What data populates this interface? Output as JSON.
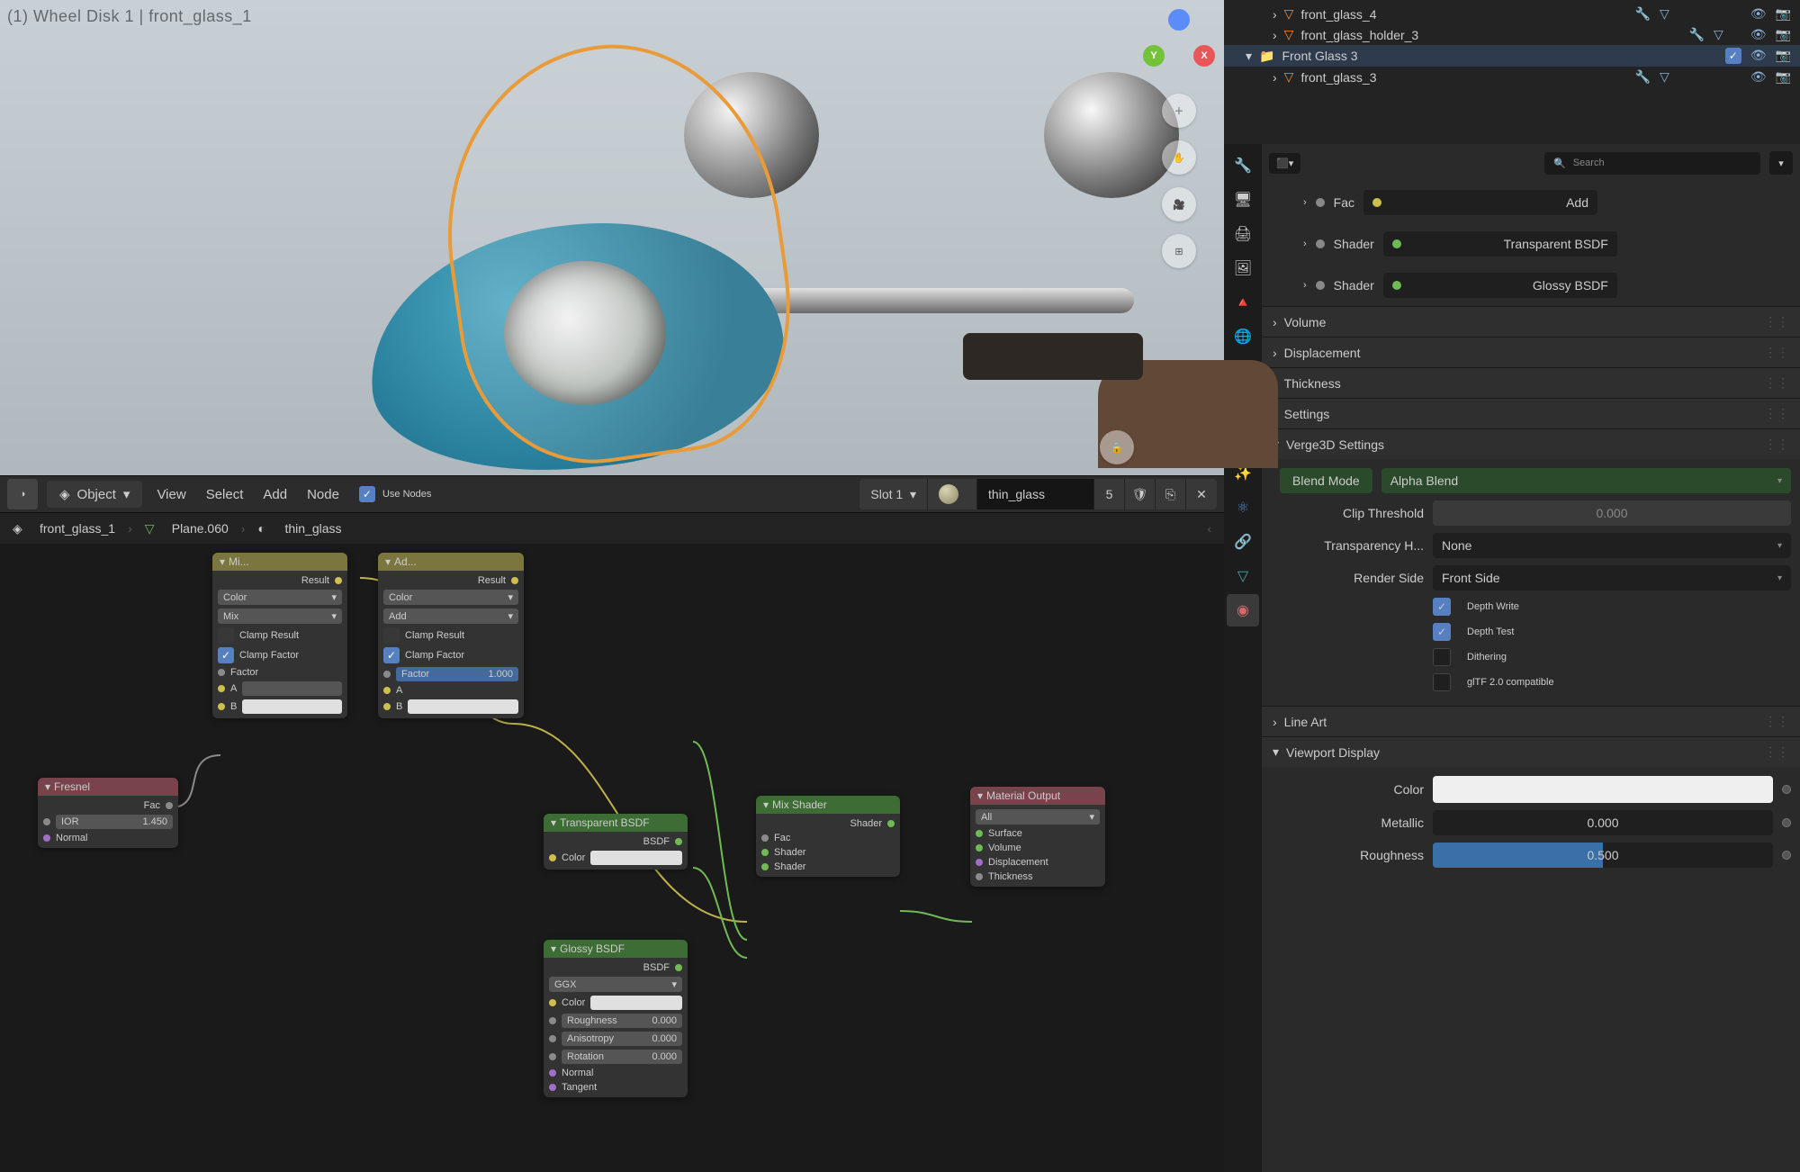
{
  "viewport": {
    "overlay_text": "(1) Wheel Disk 1 | front_glass_1",
    "gizmo": {
      "x": "X",
      "y": "Y",
      "z": ""
    }
  },
  "node_editor": {
    "header": {
      "mode": "Object",
      "menus": [
        "View",
        "Select",
        "Add",
        "Node"
      ],
      "use_nodes_label": "Use Nodes",
      "use_nodes": true,
      "slot": "Slot 1",
      "material_name": "thin_glass",
      "users": "5"
    },
    "breadcrumb": {
      "object": "front_glass_1",
      "mesh": "Plane.060",
      "material": "thin_glass"
    },
    "nodes": {
      "fresnel": {
        "title": "Fresnel",
        "out_fac": "Fac",
        "ior_label": "IOR",
        "ior_val": "1.450",
        "normal": "Normal"
      },
      "mix1": {
        "title": "Mi...",
        "result": "Result",
        "blend_type": "Color",
        "mode": "Mix",
        "clamp_result": "Clamp Result",
        "clamp_factor": "Clamp Factor",
        "factor": "Factor",
        "a": "A",
        "b": "B"
      },
      "add1": {
        "title": "Ad...",
        "result": "Result",
        "blend_type": "Color",
        "mode": "Add",
        "clamp_result": "Clamp Result",
        "clamp_factor": "Clamp Factor",
        "factor_label": "Factor",
        "factor_val": "1.000",
        "a": "A",
        "b": "B"
      },
      "transparent": {
        "title": "Transparent BSDF",
        "out": "BSDF",
        "color": "Color"
      },
      "glossy": {
        "title": "Glossy BSDF",
        "out": "BSDF",
        "dist": "GGX",
        "color": "Color",
        "roughness_l": "Roughness",
        "roughness_v": "0.000",
        "aniso_l": "Anisotropy",
        "aniso_v": "0.000",
        "rot_l": "Rotation",
        "rot_v": "0.000",
        "normal": "Normal",
        "tangent": "Tangent"
      },
      "mixshader": {
        "title": "Mix Shader",
        "out": "Shader",
        "fac": "Fac",
        "s1": "Shader",
        "s2": "Shader"
      },
      "output": {
        "title": "Material Output",
        "target": "All",
        "surface": "Surface",
        "volume": "Volume",
        "disp": "Displacement",
        "thick": "Thickness"
      }
    }
  },
  "outliner": {
    "items": [
      {
        "name": "front_glass_4",
        "indent": 2,
        "kind": "mesh"
      },
      {
        "name": "front_glass_holder_3",
        "indent": 2,
        "kind": "mesh"
      },
      {
        "name": "Front Glass 3",
        "indent": 1,
        "kind": "collection",
        "active": true
      },
      {
        "name": "front_glass_3",
        "indent": 2,
        "kind": "mesh"
      }
    ]
  },
  "properties": {
    "search_placeholder": "Search",
    "surface_inputs": {
      "fac_label": "Fac",
      "fac_value": "Add",
      "shader1_label": "Shader",
      "shader1_value": "Transparent BSDF",
      "shader2_label": "Shader",
      "shader2_value": "Glossy BSDF"
    },
    "panels": {
      "volume": "Volume",
      "displacement": "Displacement",
      "thickness": "Thickness",
      "settings": "Settings",
      "v3d": "Verge3D Settings",
      "lineart": "Line Art",
      "viewport_display": "Viewport Display"
    },
    "v3d": {
      "blend_mode_label": "Blend Mode",
      "blend_mode": "Alpha Blend",
      "clip_label": "Clip Threshold",
      "clip_val": "0.000",
      "transp_label": "Transparency H...",
      "transp_val": "None",
      "render_side_label": "Render Side",
      "render_side": "Front Side",
      "depth_write": "Depth Write",
      "depth_write_on": true,
      "depth_test": "Depth Test",
      "depth_test_on": true,
      "dithering": "Dithering",
      "dithering_on": false,
      "gltf": "glTF 2.0 compatible",
      "gltf_on": false
    },
    "viewport_display": {
      "color_label": "Color",
      "metallic_label": "Metallic",
      "metallic_val": "0.000",
      "roughness_label": "Roughness",
      "roughness_val": "0.500"
    }
  }
}
